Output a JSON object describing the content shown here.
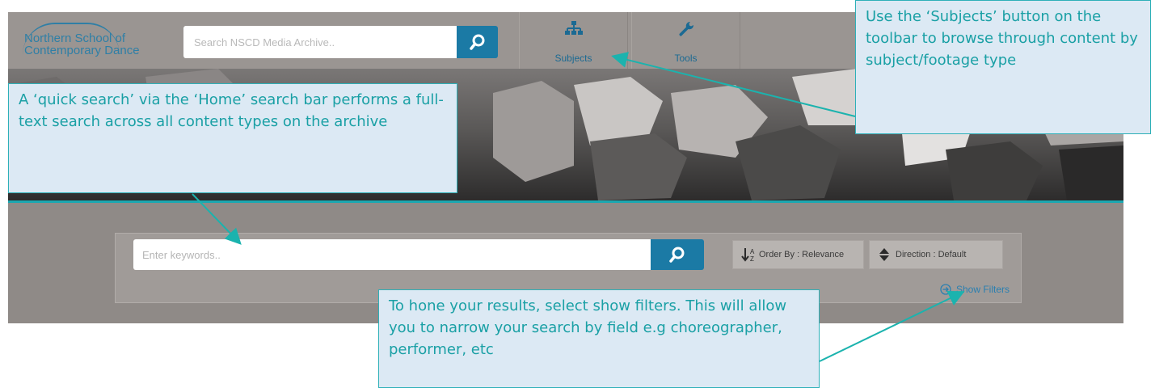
{
  "logo": {
    "text": "Northern School of\nContemporary Dance"
  },
  "toolbar": {
    "search_placeholder": "Search NSCD Media Archive..",
    "subjects_label": "Subjects",
    "tools_label": "Tools"
  },
  "search": {
    "placeholder": "Enter keywords..",
    "order_label": "Order By : Relevance",
    "direction_label": "Direction : Default",
    "show_filters_label": "Show Filters"
  },
  "callouts": {
    "subjects": "Use the ‘Subjects’ button on the toolbar to browse through content by subject/footage type",
    "quick_search": "A ‘quick search’ via the ‘Home’ search bar performs a full-text search across all content types on the archive",
    "filters": "To hone your results, select show filters. This will allow you to narrow your search by field e.g choreographer, performer, etc"
  },
  "colors": {
    "accent": "#1b7aa5",
    "callout_border": "#2eb0b8",
    "callout_text": "#1aa0a5",
    "callout_bg": "#dce9f4"
  },
  "icons": {
    "search": "magnifier-icon",
    "subjects": "sitemap-icon",
    "tools": "wrench-icon",
    "order": "sort-alpha-icon",
    "direction": "sort-arrows-icon",
    "filters": "circle-arrow-icon"
  }
}
